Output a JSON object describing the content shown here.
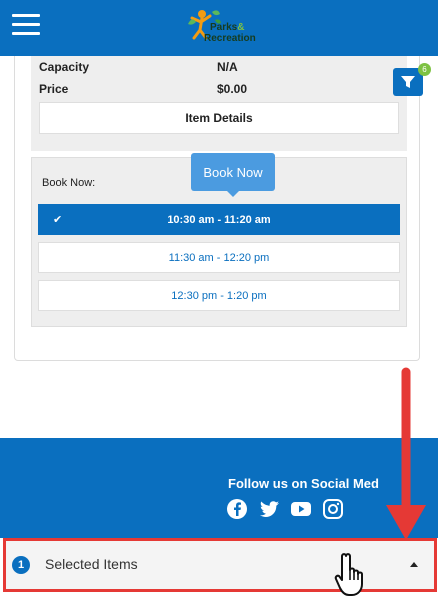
{
  "header": {
    "logo_line1": "Parks",
    "logo_line2": "Recreation",
    "logo_amp": "&"
  },
  "details": {
    "capacity_label": "Capacity",
    "capacity_value": "N/A",
    "price_label": "Price",
    "price_value": "$0.00",
    "item_details_label": "Item Details"
  },
  "filter": {
    "badge_count": "6"
  },
  "booking": {
    "label": "Book Now:",
    "tooltip": "Book Now",
    "slots": [
      {
        "time": "10:30 am - 11:20 am",
        "selected": true
      },
      {
        "time": "11:30 am - 12:20 pm",
        "selected": false
      },
      {
        "time": "12:30 pm - 1:20 pm",
        "selected": false
      }
    ]
  },
  "footer": {
    "follow_text": "Follow us on Social Med",
    "social_icons": [
      "facebook-icon",
      "twitter-icon",
      "youtube-icon",
      "instagram-icon"
    ]
  },
  "selected_bar": {
    "count": "1",
    "label": "Selected Items"
  },
  "colors": {
    "primary": "#0a6fbf",
    "badge_green": "#7ec243",
    "annotation_red": "#e53935",
    "tooltip": "#4b9be0"
  }
}
